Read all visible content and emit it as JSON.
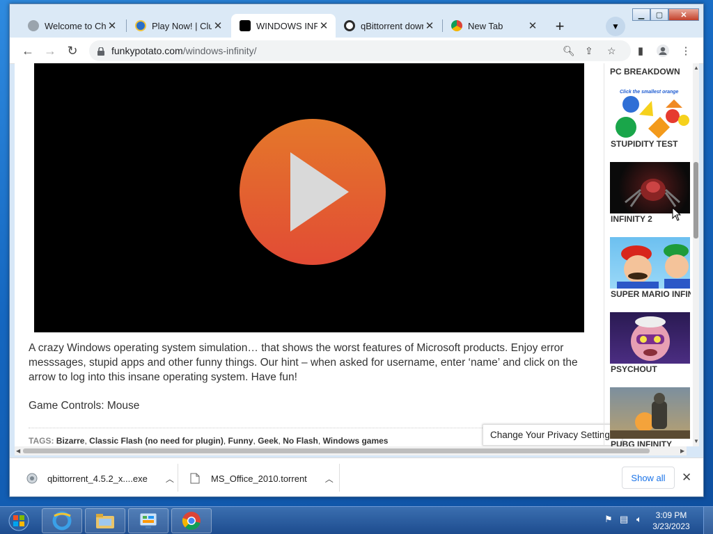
{
  "tabs": [
    {
      "title": "Welcome to Chrome",
      "icon": "globe-icon",
      "active": false
    },
    {
      "title": "Play Now! | Club Penguin",
      "icon": "penguin-icon",
      "active": false
    },
    {
      "title": "WINDOWS INFINITY",
      "icon": "site-icon",
      "active": true
    },
    {
      "title": "qBittorrent download",
      "icon": "circle-icon",
      "active": false
    },
    {
      "title": "New Tab",
      "icon": "chrome-icon",
      "active": false
    }
  ],
  "omnibox": {
    "host": "funkypotato.com",
    "path": "/windows-infinity/"
  },
  "content": {
    "description": "A crazy Windows operating system simulation… that shows the worst features of Microsoft products. Enjoy error messsages, stupid apps and other funny things. Our hint – when asked for username, enter ‘name’ and click on the arrow to log into this insane operating system. Have fun!",
    "controls": "Game Controls: Mouse",
    "tags_label": "TAGS:",
    "tags": [
      "Bizarre",
      "Classic Flash (no need for plugin)",
      "Funny",
      "Geek",
      "No Flash",
      "Windows games"
    ],
    "privacy": "Change Your Privacy Settings"
  },
  "sidebar": {
    "heading": "PC BREAKDOWN",
    "items": [
      {
        "label": "STUPIDITY TEST",
        "caption": "Click the smallest orange"
      },
      {
        "label": "INFINITY 2"
      },
      {
        "label": "SUPER MARIO INFINITY"
      },
      {
        "label": "PSYCHOUT"
      },
      {
        "label": "PUBG INFINITY"
      }
    ]
  },
  "downloads": {
    "items": [
      {
        "name": "qbittorrent_4.5.2_x....exe"
      },
      {
        "name": "MS_Office_2010.torrent"
      }
    ],
    "show_all": "Show all"
  },
  "taskbar": {
    "time": "3:09 PM",
    "date": "3/23/2023"
  }
}
